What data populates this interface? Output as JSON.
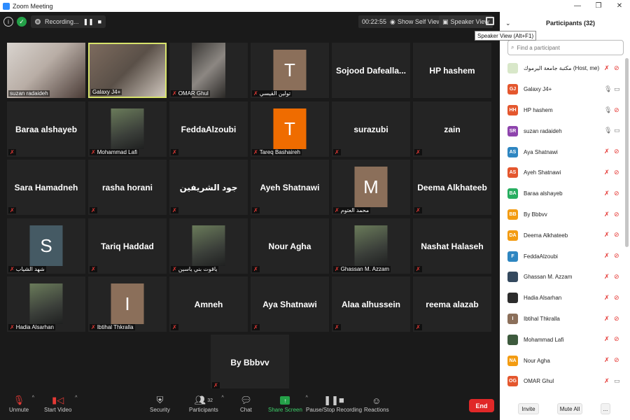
{
  "window": {
    "title": "Zoom Meeting"
  },
  "meeting": {
    "recording_label": "Recording...",
    "timer": "00:22:55",
    "self_view_label": "Show Self View",
    "speaker_view_label": "Speaker View",
    "speaker_view_tooltip": "Speaker View (Alt+F1)"
  },
  "tiles": [
    {
      "name": "suzan radaideh",
      "kind": "video",
      "muted": false,
      "active": false
    },
    {
      "name": "Galaxy J4+",
      "kind": "video",
      "muted": false,
      "active": true
    },
    {
      "name": "OMAR Ghul",
      "kind": "video",
      "muted": true,
      "active": false
    },
    {
      "name": "تولين القيسي",
      "kind": "avatar",
      "letter": "T",
      "color": "#8b6f5a",
      "muted": true
    },
    {
      "name": "Sojood Dafealla...",
      "kind": "text",
      "muted": false
    },
    {
      "name": "HP hashem",
      "kind": "text",
      "muted": false
    },
    {
      "name": "Baraa alshayeb",
      "kind": "text",
      "muted": true
    },
    {
      "name": "Mohammad Lafi",
      "kind": "photo",
      "muted": true
    },
    {
      "name": "FeddaAlzoubi",
      "kind": "text",
      "muted": true
    },
    {
      "name": "Tareq Bashaireh",
      "kind": "avatar",
      "letter": "T",
      "color": "#ef6c00",
      "muted": true
    },
    {
      "name": "surazubi",
      "kind": "text",
      "muted": true
    },
    {
      "name": "zain",
      "kind": "text",
      "muted": true
    },
    {
      "name": "Sara Hamadneh",
      "kind": "text",
      "muted": true
    },
    {
      "name": "rasha horani",
      "kind": "text",
      "muted": true
    },
    {
      "name": "جود الشريفين",
      "kind": "text",
      "muted": true
    },
    {
      "name": "Ayeh Shatnawi",
      "kind": "text",
      "muted": true
    },
    {
      "name": "محمد العتوم",
      "kind": "avatar",
      "letter": "M",
      "color": "#8b6f5a",
      "muted": true
    },
    {
      "name": "Deema Alkhateeb",
      "kind": "text",
      "muted": true
    },
    {
      "name": "شهد الشياب",
      "kind": "avatar",
      "letter": "S",
      "color": "#455a64",
      "muted": true
    },
    {
      "name": "Tariq Haddad",
      "kind": "text",
      "muted": true
    },
    {
      "name": "ياقوت بني ياسين",
      "kind": "photo",
      "muted": true
    },
    {
      "name": "Nour Agha",
      "kind": "text",
      "muted": true
    },
    {
      "name": "Ghassan M. Azzam",
      "kind": "photo",
      "muted": true
    },
    {
      "name": "Nashat Halaseh",
      "kind": "text",
      "muted": true
    },
    {
      "name": "Hadia Alsarhan",
      "kind": "photo",
      "muted": true
    },
    {
      "name": "Ibtihal Thkralla",
      "kind": "avatar",
      "letter": "I",
      "color": "#8b6f5a",
      "muted": true
    },
    {
      "name": "Amneh",
      "kind": "text",
      "muted": true
    },
    {
      "name": "Aya Shatnawi",
      "kind": "text",
      "muted": true
    },
    {
      "name": "Alaa alhussein",
      "kind": "text",
      "muted": true
    },
    {
      "name": "reema alazab",
      "kind": "text",
      "muted": true
    },
    {
      "name": "By Bbbvv",
      "kind": "text",
      "muted": true
    }
  ],
  "toolbar": {
    "unmute": "Unmute",
    "start_video": "Start Video",
    "security": "Security",
    "participants": "Participants",
    "participants_count": "32",
    "chat": "Chat",
    "share_screen": "Share Screen",
    "pause_recording": "Pause/Stop Recording",
    "reactions": "Reactions",
    "end": "End"
  },
  "panel": {
    "title": "Participants (32)",
    "search_placeholder": "Find a participant",
    "participants": [
      {
        "initials": "",
        "name": "مكتبة جامعة اليرموك",
        "suffix": "(Host, me)",
        "color": "#d8e7c9",
        "mic": "off",
        "cam": "off"
      },
      {
        "initials": "GJ",
        "name": "Galaxy J4+",
        "color": "#e4572e",
        "mic": "on",
        "cam": "on"
      },
      {
        "initials": "HH",
        "name": "HP hashem",
        "color": "#e4572e",
        "mic": "on",
        "cam": "off"
      },
      {
        "initials": "SR",
        "name": "suzan radaideh",
        "color": "#8e44ad",
        "mic": "on",
        "cam": "on"
      },
      {
        "initials": "AS",
        "name": "Aya Shatnawi",
        "color": "#2e86c1",
        "mic": "off",
        "cam": "off"
      },
      {
        "initials": "AS",
        "name": "Ayeh Shatnawi",
        "color": "#e4572e",
        "mic": "off",
        "cam": "off"
      },
      {
        "initials": "BA",
        "name": "Baraa alshayeb",
        "color": "#27ae60",
        "mic": "off",
        "cam": "off"
      },
      {
        "initials": "BB",
        "name": "By Bbbvv",
        "color": "#f39c12",
        "mic": "off",
        "cam": "off"
      },
      {
        "initials": "DA",
        "name": "Deema Alkhateeb",
        "color": "#f39c12",
        "mic": "off",
        "cam": "off"
      },
      {
        "initials": "F",
        "name": "FeddaAlzoubi",
        "color": "#2e86c1",
        "mic": "off",
        "cam": "off"
      },
      {
        "initials": "",
        "name": "Ghassan M. Azzam",
        "color": "#34495e",
        "mic": "off",
        "cam": "off"
      },
      {
        "initials": "",
        "name": "Hadia Alsarhan",
        "color": "#2c2c2c",
        "mic": "off",
        "cam": "off"
      },
      {
        "initials": "I",
        "name": "Ibtihal Thkralla",
        "color": "#8b6f5a",
        "mic": "off",
        "cam": "off"
      },
      {
        "initials": "",
        "name": "Mohammad Lafi",
        "color": "#3d5a3d",
        "mic": "off",
        "cam": "off"
      },
      {
        "initials": "NA",
        "name": "Nour Agha",
        "color": "#f39c12",
        "mic": "off",
        "cam": "off"
      },
      {
        "initials": "OG",
        "name": "OMAR Ghul",
        "color": "#e4572e",
        "mic": "off",
        "cam": "on"
      }
    ],
    "invite": "Invite",
    "mute_all": "Mute All",
    "more": "..."
  }
}
